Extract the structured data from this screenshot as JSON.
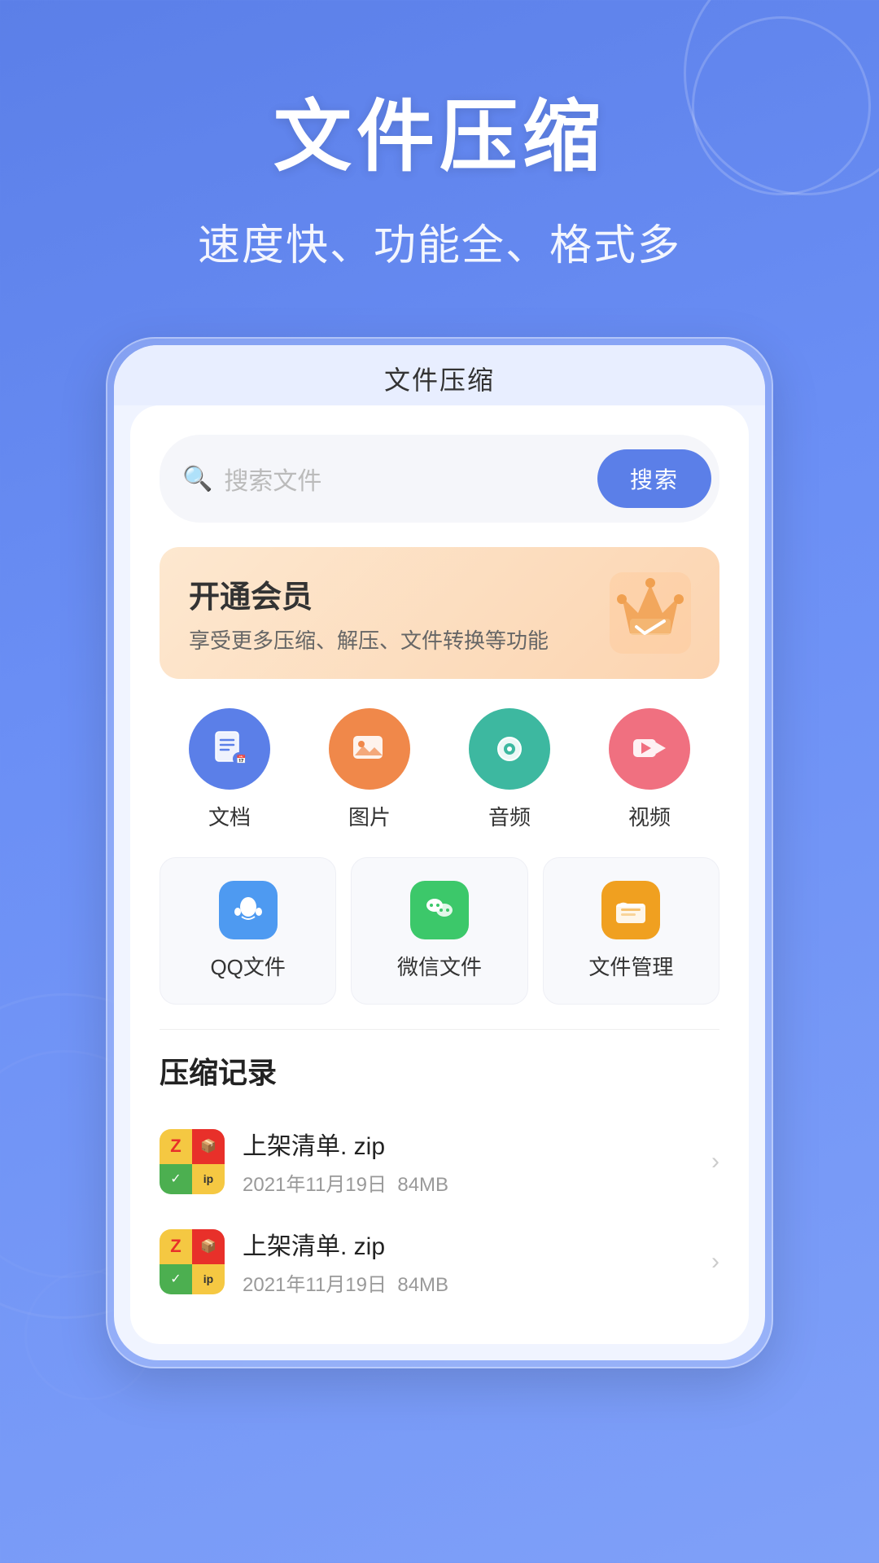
{
  "header": {
    "main_title": "文件压缩",
    "subtitle": "速度快、功能全、格式多"
  },
  "app_title": "文件压缩",
  "search": {
    "placeholder": "搜索文件",
    "button_label": "搜索"
  },
  "vip_banner": {
    "title": "开通会员",
    "description": "享受更多压缩、解压、文件转换等功能"
  },
  "categories": [
    {
      "id": "doc",
      "label": "文档",
      "color": "#5b7fe8",
      "icon": "📋"
    },
    {
      "id": "img",
      "label": "图片",
      "color": "#f0884a",
      "icon": "🖼️"
    },
    {
      "id": "audio",
      "label": "音频",
      "color": "#3db8a0",
      "icon": "🎙️"
    },
    {
      "id": "video",
      "label": "视频",
      "color": "#f07080",
      "icon": "🎬"
    }
  ],
  "file_sources": [
    {
      "id": "qq",
      "label": "QQ文件",
      "bg_color": "#4e9af1",
      "icon": "🐧"
    },
    {
      "id": "wechat",
      "label": "微信文件",
      "bg_color": "#3cc86a",
      "icon": "💬"
    },
    {
      "id": "manager",
      "label": "文件管理",
      "bg_color": "#f0a020",
      "icon": "📁"
    }
  ],
  "records_title": "压缩记录",
  "records": [
    {
      "name": "上架清单. zip",
      "date": "2021年11月19日",
      "size": "84MB"
    },
    {
      "name": "上架清单. zip",
      "date": "2021年11月19日",
      "size": "84MB"
    }
  ],
  "colors": {
    "primary": "#5b7fe8",
    "bg_gradient_start": "#5b7fe8",
    "bg_gradient_end": "#7fa0f8"
  }
}
